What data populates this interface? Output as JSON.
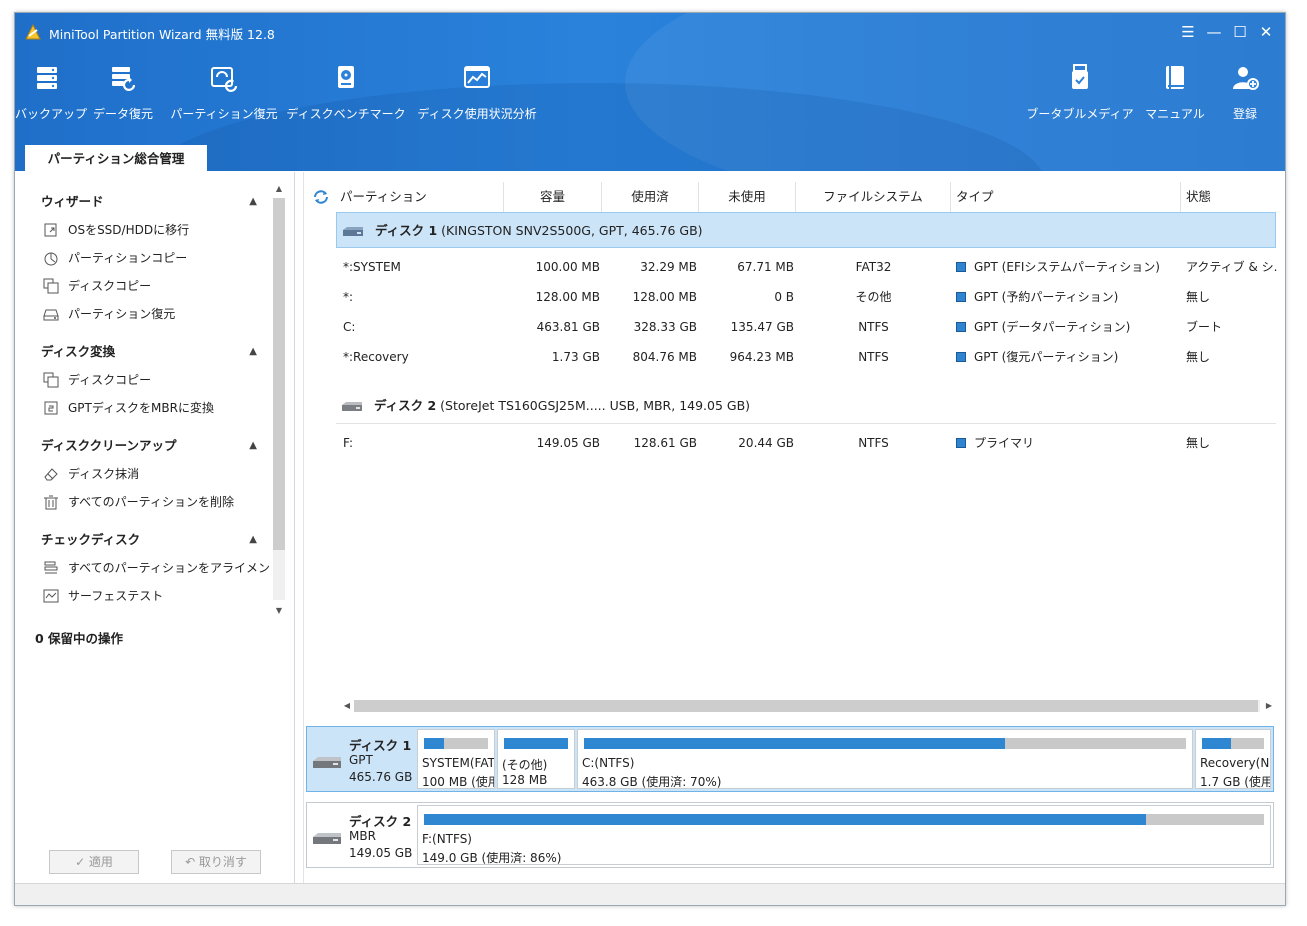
{
  "app": {
    "title": "MiniTool Partition Wizard 無料版 12.8",
    "window_controls": [
      "☰",
      "—",
      "☐",
      "✕"
    ]
  },
  "toolbar": {
    "left": [
      {
        "label": "バックアップ",
        "icon": "backup-icon"
      },
      {
        "label": "データ復元",
        "icon": "data-recovery-icon"
      },
      {
        "label": "パーティション復元",
        "icon": "partition-recovery-icon"
      },
      {
        "label": "ディスクベンチマーク",
        "icon": "disk-benchmark-icon"
      },
      {
        "label": "ディスク使用状況分析",
        "icon": "space-analyzer-icon"
      }
    ],
    "right": [
      {
        "label": "ブータブルメディア",
        "icon": "bootable-media-icon"
      },
      {
        "label": "マニュアル",
        "icon": "manual-icon"
      },
      {
        "label": "登録",
        "icon": "register-icon"
      }
    ]
  },
  "main_tab": "パーティション総合管理",
  "sidebar": {
    "sections": [
      {
        "title": "ウィザード",
        "items": [
          "OSをSSD/HDDに移行",
          "パーティションコピー",
          "ディスクコピー",
          "パーティション復元"
        ]
      },
      {
        "title": "ディスク変換",
        "items": [
          "ディスクコピー",
          "GPTディスクをMBRに変換"
        ]
      },
      {
        "title": "ディスククリーンアップ",
        "items": [
          "ディスク抹消",
          "すべてのパーティションを削除"
        ]
      },
      {
        "title": "チェックディスク",
        "items": [
          "すべてのパーティションをアライメント",
          "サーフェステスト"
        ]
      }
    ],
    "pending": "0 保留中の操作",
    "apply": "✓ 適用",
    "undo": "↶ 取り消す"
  },
  "grid": {
    "headers": [
      "パーティション",
      "容量",
      "使用済",
      "未使用",
      "ファイルシステム",
      "タイプ",
      "状態"
    ],
    "disks": [
      {
        "name": "ディスク 1",
        "detail": "(KINGSTON SNV2S500G, GPT, 465.76 GB)",
        "partitions": [
          {
            "name": "*:SYSTEM",
            "capacity": "100.00 MB",
            "used": "32.29 MB",
            "unused": "67.71 MB",
            "fs": "FAT32",
            "type": "GPT (EFIシステムパーティション)",
            "status": "アクティブ & シ..."
          },
          {
            "name": "*:",
            "capacity": "128.00 MB",
            "used": "128.00 MB",
            "unused": "0 B",
            "fs": "その他",
            "type": "GPT (予約パーティション)",
            "status": "無し"
          },
          {
            "name": "C:",
            "capacity": "463.81 GB",
            "used": "328.33 GB",
            "unused": "135.47 GB",
            "fs": "NTFS",
            "type": "GPT (データパーティション)",
            "status": "ブート"
          },
          {
            "name": "*:Recovery",
            "capacity": "1.73 GB",
            "used": "804.76 MB",
            "unused": "964.23 MB",
            "fs": "NTFS",
            "type": "GPT (復元パーティション)",
            "status": "無し"
          }
        ]
      },
      {
        "name": "ディスク 2",
        "detail": "(StoreJet TS160GSJ25M..... USB, MBR, 149.05 GB)",
        "partitions": [
          {
            "name": "F:",
            "capacity": "149.05 GB",
            "used": "128.61 GB",
            "unused": "20.44 GB",
            "fs": "NTFS",
            "type": "プライマリ",
            "status": "無し"
          }
        ]
      }
    ]
  },
  "disk_map": [
    {
      "name": "ディスク 1",
      "scheme": "GPT",
      "size": "465.76 GB",
      "partitions": [
        {
          "label": "SYSTEM(FAT",
          "sub": "100 MB (使用",
          "used_fraction": 0.32
        },
        {
          "label": "(その他)",
          "sub": "128 MB",
          "used_fraction": 1.0
        },
        {
          "label": "C:(NTFS)",
          "sub": "463.8 GB (使用済: 70%)",
          "used_fraction": 0.7
        },
        {
          "label": "Recovery(N",
          "sub": "1.7 GB (使用",
          "used_fraction": 0.46
        }
      ]
    },
    {
      "name": "ディスク 2",
      "scheme": "MBR",
      "size": "149.05 GB",
      "partitions": [
        {
          "label": "F:(NTFS)",
          "sub": "149.0 GB (使用済: 86%)",
          "used_fraction": 0.86
        }
      ]
    }
  ],
  "colors": {
    "header": "#2a82db",
    "selection": "#cce4f7",
    "bar_fill": "#2f86d1",
    "bar_empty": "#c9c9c9"
  }
}
